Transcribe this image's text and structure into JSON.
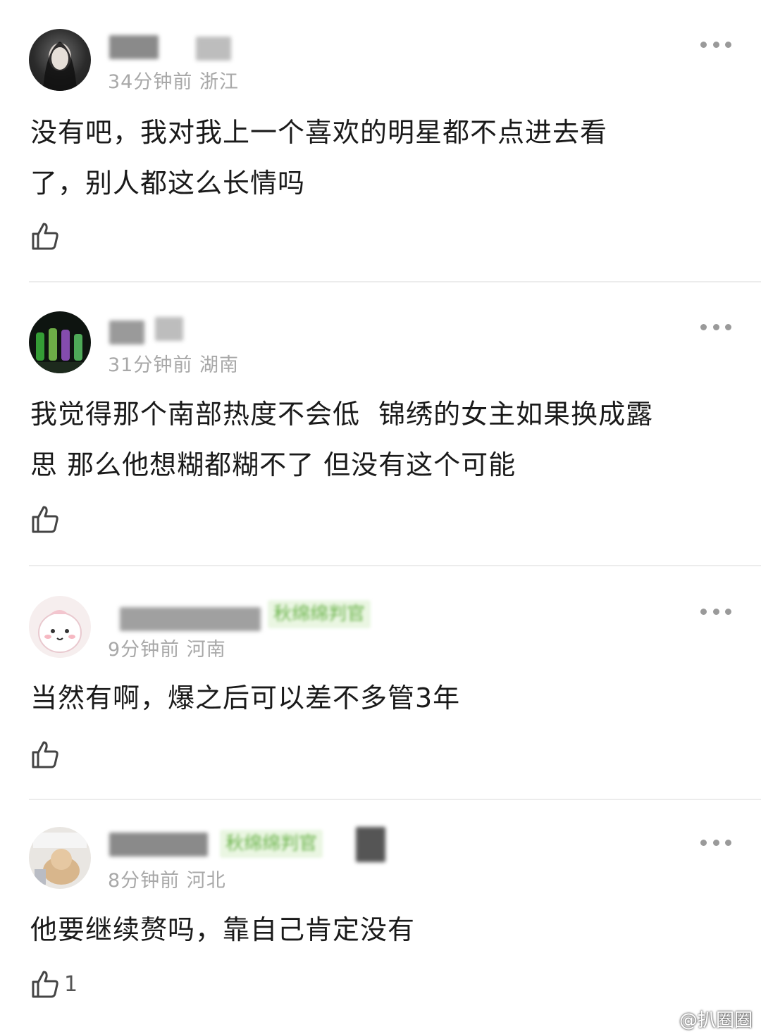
{
  "comments": [
    {
      "meta": "34分钟前 浙江",
      "text": "没有吧，我对我上一个喜欢的明星都不点进去看\n了，别人都这么长情吗",
      "like_count": ""
    },
    {
      "meta": "31分钟前 湖南",
      "text": "我觉得那个南部热度不会低  锦绣的女主如果换成露\n思 那么他想糊都糊不了 但没有这个可能",
      "like_count": ""
    },
    {
      "meta": "9分钟前 河南",
      "badge": "秋绵绵判官",
      "text": "当然有啊，爆之后可以差不多管3年",
      "like_count": ""
    },
    {
      "meta": "8分钟前 河北",
      "badge": "秋绵绵判官",
      "text": "他要继续赘吗，靠自己肯定没有",
      "like_count": "1"
    }
  ],
  "watermark": "@扒圈圈",
  "icons": {
    "more": "more-dots-icon",
    "like": "thumbs-up-icon",
    "watermark_logo": "weibo-logo-icon"
  },
  "colors": {
    "meta_gray": "#a8a8a8",
    "badge_green": "#6ab34a",
    "badge_bg": "#eaf6e2"
  }
}
